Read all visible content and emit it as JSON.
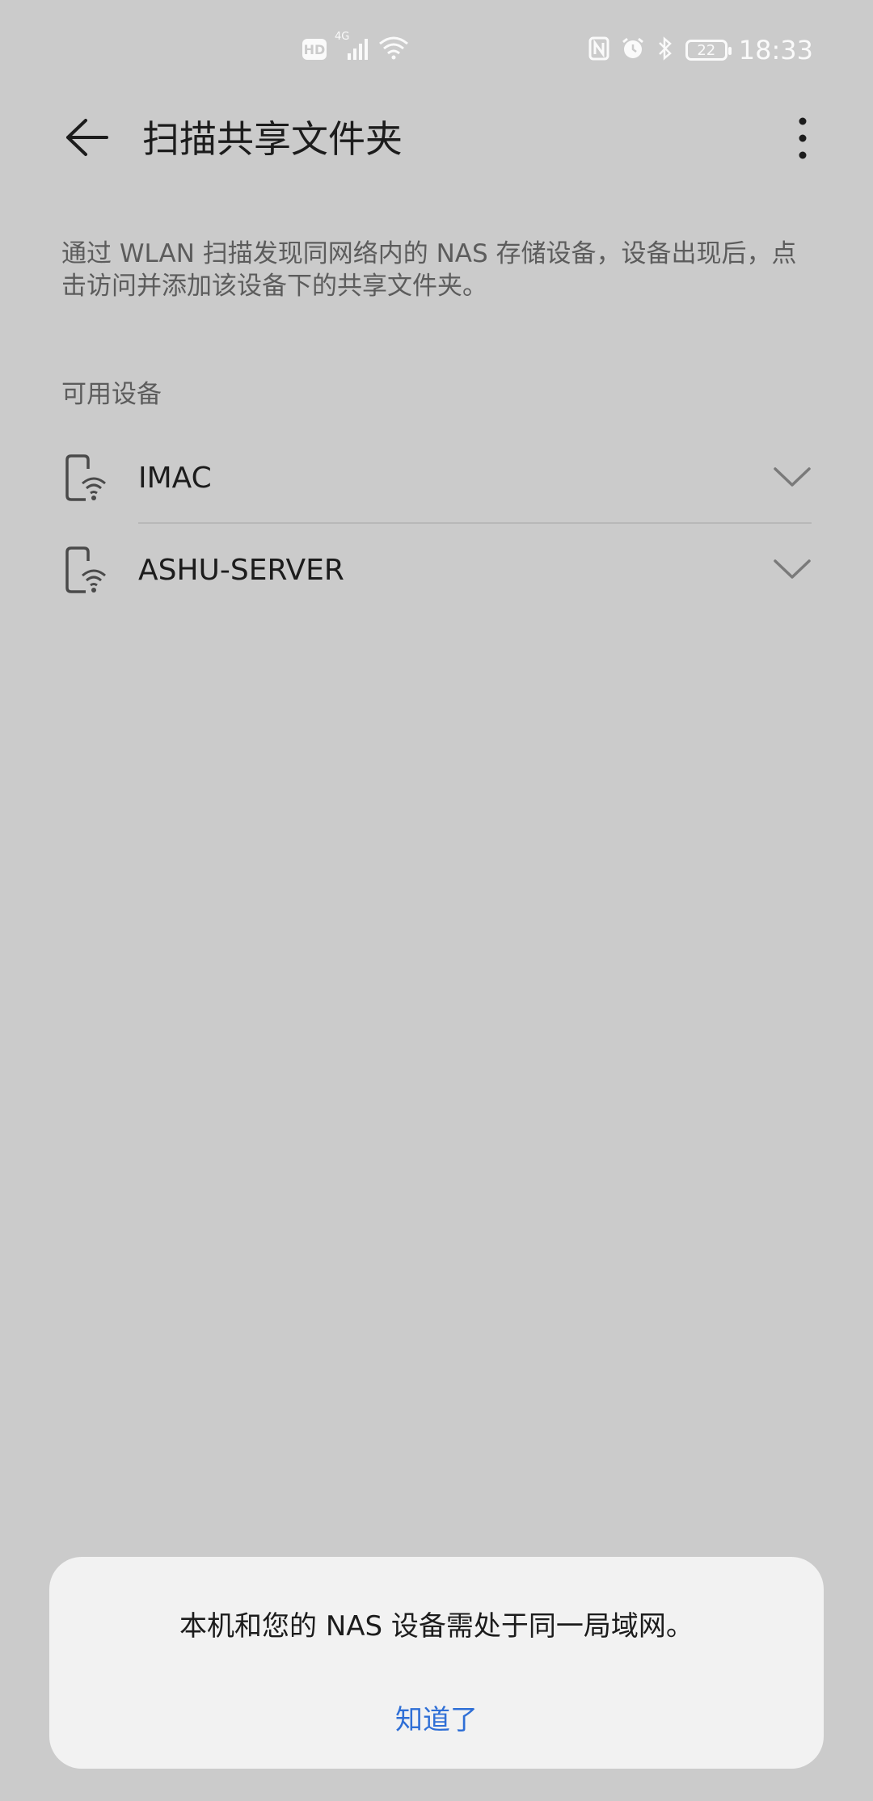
{
  "status_bar": {
    "time": "18:33",
    "battery_level": "22",
    "hd_label": "HD",
    "network_type": "4G",
    "icons": [
      "hd-icon",
      "cellular-signal-icon",
      "wifi-icon",
      "nfc-icon",
      "alarm-icon",
      "bluetooth-icon",
      "battery-icon"
    ]
  },
  "app_bar": {
    "title": "扫描共享文件夹",
    "back_icon": "back-arrow-icon",
    "more_icon": "more-vert-icon"
  },
  "description": "通过 WLAN 扫描发现同网络内的 NAS 存储设备，设备出现后，点击访问并添加该设备下的共享文件夹。",
  "section": {
    "title": "可用设备"
  },
  "devices": [
    {
      "name": "IMAC",
      "icon": "phone-wifi-icon",
      "expand_icon": "chevron-down-icon"
    },
    {
      "name": "ASHU-SERVER",
      "icon": "phone-wifi-icon",
      "expand_icon": "chevron-down-icon"
    }
  ],
  "dialog": {
    "message": "本机和您的 NAS 设备需处于同一局域网。",
    "button_label": "知道了"
  },
  "colors": {
    "background": "#cbcbcb",
    "dialog_background": "#f2f2f2",
    "accent": "#2f6fd6"
  }
}
